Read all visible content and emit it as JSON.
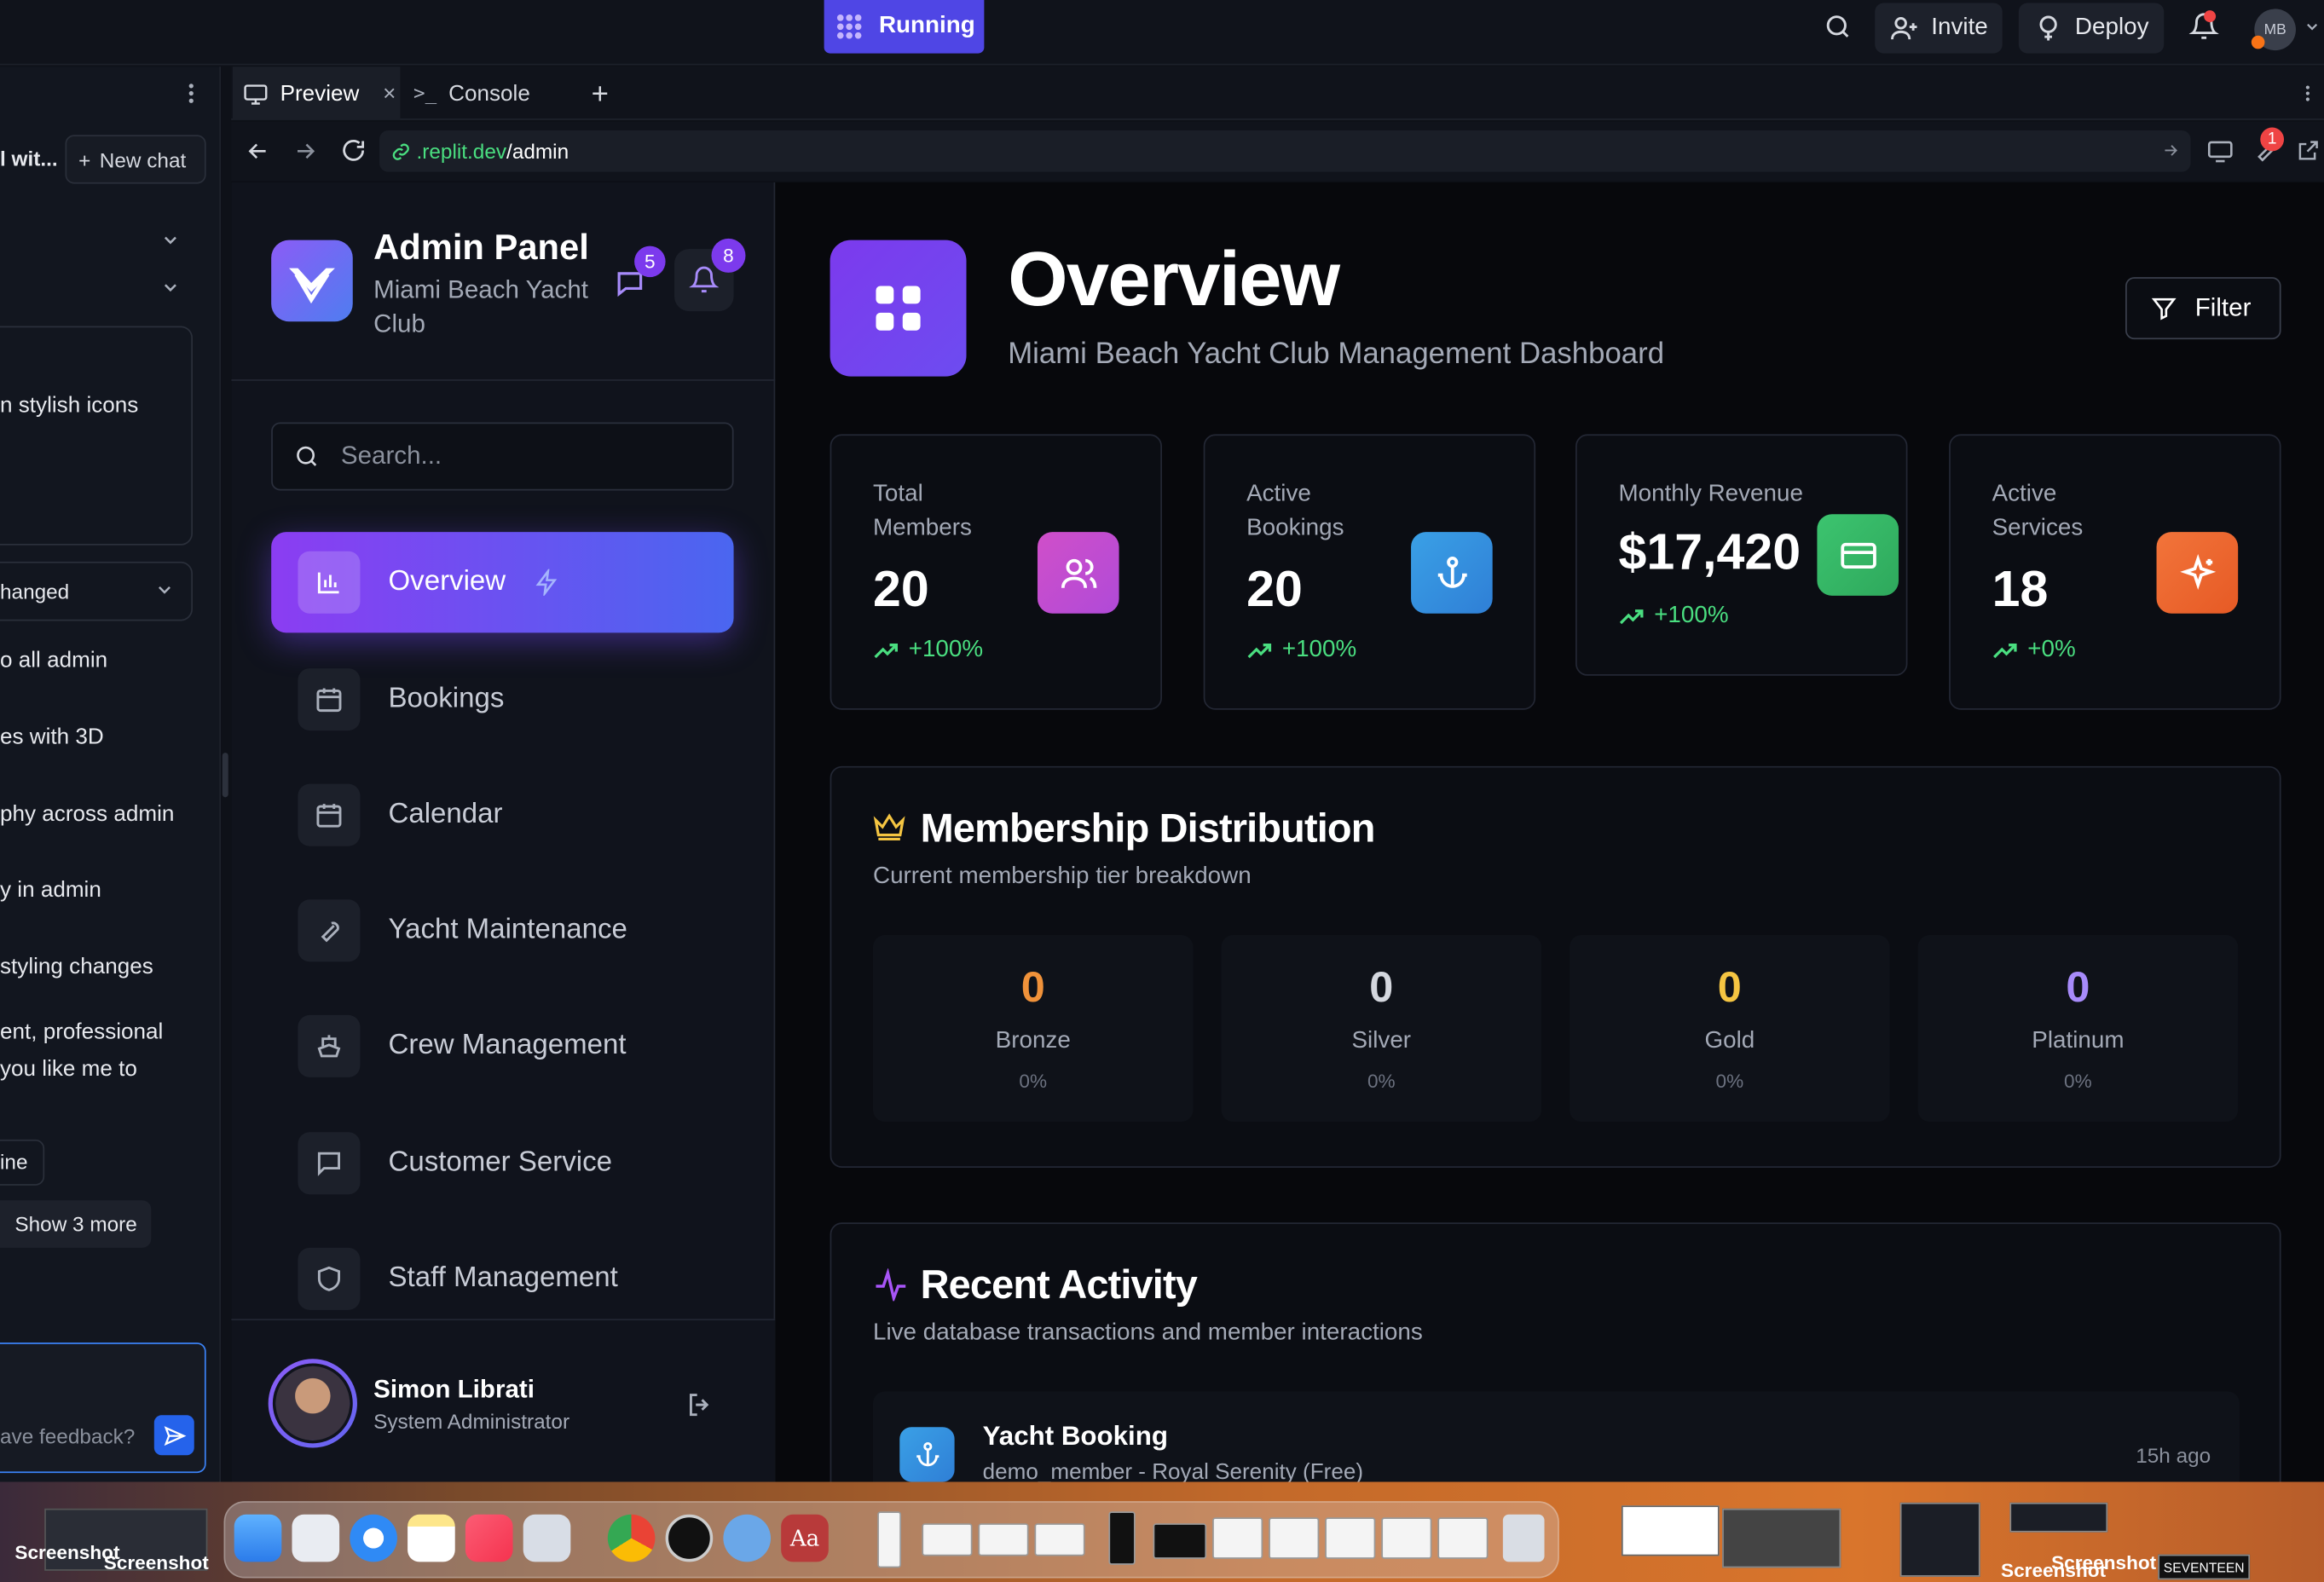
{
  "topbar": {
    "status": "Running",
    "invite_label": "Invite",
    "deploy_label": "Deploy",
    "user_initials": "MB"
  },
  "chat": {
    "title_fragment": "l wit...",
    "new_chat_label": "New chat",
    "lines": [
      "n stylish icons",
      "hanged",
      "o all admin",
      "es with 3D",
      "phy across admin",
      "y in admin",
      "styling changes",
      "ent, professional",
      "you like me to",
      "ine",
      "Show 3 more"
    ],
    "input_placeholder": "ave feedback?"
  },
  "tabs": {
    "preview": "Preview",
    "console": "Console"
  },
  "url": {
    "domain": ".replit.dev",
    "path": "/admin",
    "badge": "1"
  },
  "sidebar": {
    "title": "Admin Panel",
    "subtitle_line1": "Miami Beach Yacht",
    "subtitle_line2": "Club",
    "messages_badge": "5",
    "notifications_badge": "8",
    "search_placeholder": "Search...",
    "nav": [
      {
        "label": "Overview",
        "icon": "bar-chart-icon",
        "active": true
      },
      {
        "label": "Bookings",
        "icon": "calendar-icon"
      },
      {
        "label": "Calendar",
        "icon": "calendar-days-icon"
      },
      {
        "label": "Yacht Maintenance",
        "icon": "wrench-icon"
      },
      {
        "label": "Crew Management",
        "icon": "ship-icon"
      },
      {
        "label": "Customer Service",
        "icon": "message-square-icon"
      },
      {
        "label": "Staff Management",
        "icon": "shield-icon"
      }
    ],
    "user": {
      "name": "Simon Librati",
      "role": "System Administrator"
    }
  },
  "main": {
    "title": "Overview",
    "subtitle": "Miami Beach Yacht Club Management Dashboard",
    "filter_label": "Filter",
    "stats": [
      {
        "label_line1": "Total",
        "label_line2": "Members",
        "value": "20",
        "change": "+100%",
        "icon": "users-icon",
        "color": "#c84fd0"
      },
      {
        "label_line1": "Active",
        "label_line2": "Bookings",
        "value": "20",
        "change": "+100%",
        "icon": "anchor-icon",
        "color": "#3b8fe0"
      },
      {
        "label_line1": "Monthly Revenue",
        "label_line2": "",
        "value": "$17,420",
        "change": "+100%",
        "icon": "credit-card-icon",
        "color": "#31b866"
      },
      {
        "label_line1": "Active",
        "label_line2": "Services",
        "value": "18",
        "change": "+0%",
        "icon": "sparkles-icon",
        "color": "#ef6a2c"
      }
    ],
    "membership": {
      "title": "Membership Distribution",
      "subtitle": "Current membership tier breakdown",
      "tiers": [
        {
          "count": "0",
          "name": "Bronze",
          "pct": "0%",
          "color": "#f0923a"
        },
        {
          "count": "0",
          "name": "Silver",
          "pct": "0%",
          "color": "#d4d7de"
        },
        {
          "count": "0",
          "name": "Gold",
          "pct": "0%",
          "color": "#f5c542"
        },
        {
          "count": "0",
          "name": "Platinum",
          "pct": "0%",
          "color": "#a78bfa"
        }
      ]
    },
    "activity": {
      "title": "Recent Activity",
      "subtitle": "Live database transactions and member interactions",
      "items": [
        {
          "title": "Yacht Booking",
          "detail": "demo_member - Royal Serenity (Free)",
          "time": "15h ago"
        }
      ]
    }
  },
  "dock": {
    "labels": [
      "Screenshot",
      "Screenshot",
      "Screenshot",
      "Screenshot",
      "SEVENTEEN"
    ]
  }
}
